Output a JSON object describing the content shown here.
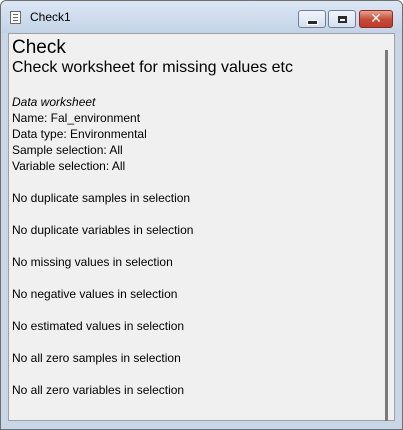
{
  "window": {
    "title": "Check1"
  },
  "report": {
    "title": "Check",
    "subtitle": "Check worksheet for missing values etc",
    "section_heading": "Data worksheet",
    "name_line": "Name: Fal_environment",
    "type_line": "Data type: Environmental",
    "sample_line": "Sample selection: All",
    "variable_line": "Variable selection: All",
    "checks": [
      "No duplicate samples in selection",
      "No duplicate variables in selection",
      "No missing values in selection",
      "No negative values in selection",
      "No estimated values in selection",
      "No all zero samples in selection",
      "No all zero variables in selection"
    ]
  },
  "icons": {
    "window_icon": "document-icon",
    "minimize": "minimize-icon",
    "maximize": "maximize-icon",
    "close": "close-icon"
  },
  "colors": {
    "close_button": "#c74a34",
    "titlebar": "#c3d3e7",
    "client_background": "#f0f0f0"
  }
}
